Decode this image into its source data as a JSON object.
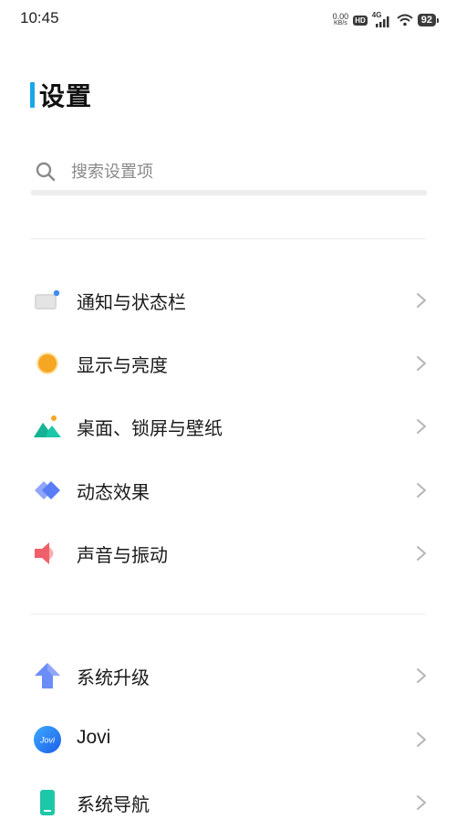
{
  "status_bar": {
    "time": "10:45",
    "net_speed_value": "0.00",
    "net_speed_unit": "KB/s",
    "hd_badge": "HD",
    "network_type": "4G",
    "battery": "92"
  },
  "page": {
    "title": "设置"
  },
  "search": {
    "placeholder": "搜索设置项"
  },
  "groups": [
    {
      "items": [
        {
          "label": "通知与状态栏",
          "icon": "notification-status-bar-icon"
        },
        {
          "label": "显示与亮度",
          "icon": "display-brightness-icon"
        },
        {
          "label": "桌面、锁屏与壁纸",
          "icon": "wallpaper-icon"
        },
        {
          "label": "动态效果",
          "icon": "dynamic-effects-icon"
        },
        {
          "label": "声音与振动",
          "icon": "sound-vibration-icon"
        }
      ]
    },
    {
      "items": [
        {
          "label": "系统升级",
          "icon": "system-upgrade-icon"
        },
        {
          "label": "Jovi",
          "icon": "jovi-icon",
          "badge_text": "Jovi"
        },
        {
          "label": "系统导航",
          "icon": "system-navigation-icon"
        }
      ]
    }
  ],
  "colors": {
    "title_accent": "#1aa7e8",
    "orange": "#f5a623",
    "teal": "#1dc8a8",
    "blue_purple": "#5b7cf7",
    "red": "#f0606a"
  }
}
